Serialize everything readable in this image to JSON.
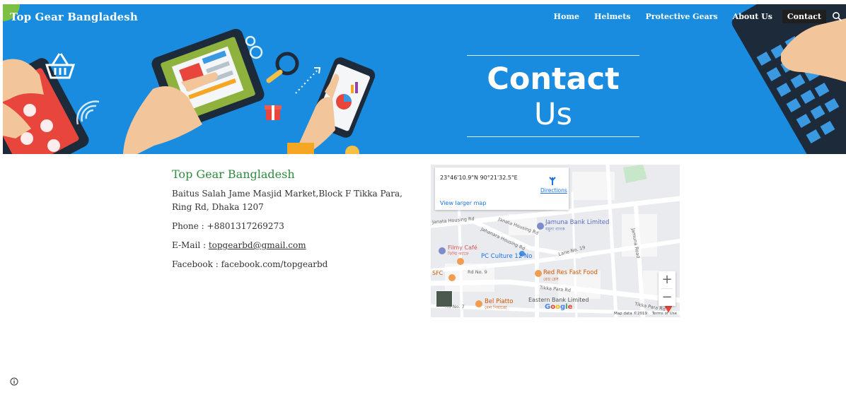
{
  "header": {
    "brand": "Top Gear Bangladesh",
    "nav": [
      {
        "label": "Home"
      },
      {
        "label": "Helmets"
      },
      {
        "label": "Protective Gears"
      },
      {
        "label": "About Us"
      },
      {
        "label": "Contact"
      }
    ],
    "active_nav": "Contact"
  },
  "hero": {
    "title_bold": "Contact",
    "title_light": "Us"
  },
  "contact": {
    "name": "Top Gear Bangladesh",
    "address": "Baitus Salah Jame Masjid Market,Block F Tikka Para, Ring Rd, Dhaka 1207",
    "phone": "Phone : +8801317269273",
    "email_label": "E-Mail : ",
    "email": "topgearbd@gmail.com",
    "facebook": "Facebook : facebook.com/topgearbd"
  },
  "map": {
    "coordinates": "23°46'10.9\"N 90°21'32.5\"E",
    "directions": "Directions",
    "view_larger": "View larger map",
    "places": [
      {
        "name": "Jamuna Bank Limited",
        "sub": "যমুনা ব্যাংক"
      },
      {
        "name": "Filmy Café",
        "sub": "ফিল্মি ক্যাফে"
      },
      {
        "name": "PC Culture 12 No"
      },
      {
        "name": "Red Res Fast Food",
        "sub": "রেড রেস"
      },
      {
        "name": "Bel Piatto",
        "sub": "বেল পিয়াত্তো"
      },
      {
        "name": "Eastern Bank Limited"
      },
      {
        "name": "SFC"
      }
    ],
    "roads": [
      "Janata Housing Rd",
      "Jahanara Housing Rd",
      "Janata Housing Rd",
      "Lane No. 19",
      "Rd No. 9",
      "Tikka Para Rd",
      "Tikka Para Rd",
      "Jamuna Road",
      "Rd No. 7"
    ],
    "zoom_in": "+",
    "zoom_out": "−",
    "google": "Google",
    "map_data": "Map data ©2019",
    "terms": "Terms of Use"
  },
  "colors": {
    "hero_blue": "#1a8ce0",
    "heading_green": "#2e8b3e",
    "active_nav_bg": "#1f1f1f"
  },
  "icons": {
    "search": "search-icon",
    "info": "info-icon",
    "directions": "directions-icon",
    "zoom_in": "plus-icon",
    "zoom_out": "minus-icon"
  }
}
